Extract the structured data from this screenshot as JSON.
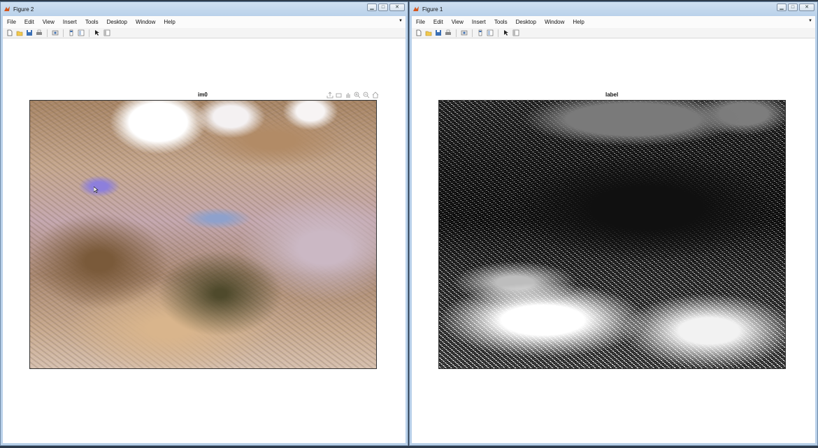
{
  "windows": [
    {
      "title": "Figure 2",
      "menu": [
        "File",
        "Edit",
        "View",
        "Insert",
        "Tools",
        "Desktop",
        "Window",
        "Help"
      ],
      "axes_title": "im0"
    },
    {
      "title": "Figure 1",
      "menu": [
        "File",
        "Edit",
        "View",
        "Insert",
        "Tools",
        "Desktop",
        "Window",
        "Help"
      ],
      "axes_title": "label"
    }
  ],
  "icons": {
    "toolbar": [
      "new-figure-icon",
      "open-file-icon",
      "save-icon",
      "print-icon",
      "link-icon",
      "colorbar-icon",
      "legend-icon",
      "pointer-icon",
      "property-editor-icon"
    ],
    "axes_toolbar": [
      "export-icon",
      "brush-icon",
      "pan-icon",
      "zoom-in-icon",
      "zoom-out-icon",
      "home-icon"
    ]
  },
  "colors": {
    "titlebar": "#b9d1ea",
    "desktop": "#2d3a4a"
  }
}
